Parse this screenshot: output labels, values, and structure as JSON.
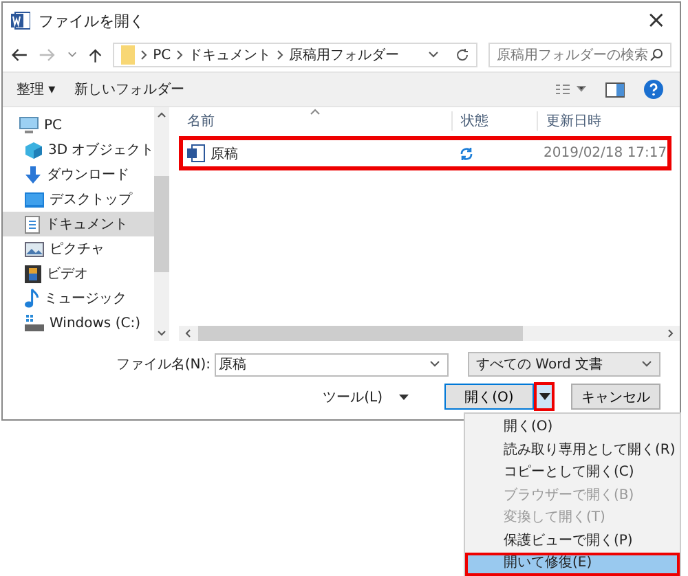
{
  "window": {
    "title": "ファイルを開く",
    "close": "×"
  },
  "address": {
    "crumbs": [
      "PC",
      "ドキュメント",
      "原稿用フォルダー"
    ],
    "search_placeholder": "原稿用フォルダーの検索"
  },
  "toolbar": {
    "organize": "整理 ▾",
    "new_folder": "新しいフォルダー"
  },
  "sidebar": {
    "items": [
      {
        "label": "PC",
        "kind": "pc",
        "selected": false
      },
      {
        "label": "3D オブジェクト",
        "kind": "cube",
        "selected": false
      },
      {
        "label": "ダウンロード",
        "kind": "download",
        "selected": false
      },
      {
        "label": "デスクトップ",
        "kind": "desktop",
        "selected": false
      },
      {
        "label": "ドキュメント",
        "kind": "document",
        "selected": true
      },
      {
        "label": "ピクチャ",
        "kind": "picture",
        "selected": false
      },
      {
        "label": "ビデオ",
        "kind": "video",
        "selected": false
      },
      {
        "label": "ミュージック",
        "kind": "music",
        "selected": false
      },
      {
        "label": "Windows (C:)",
        "kind": "drive",
        "selected": false
      }
    ]
  },
  "table": {
    "columns": [
      "名前",
      "状態",
      "更新日時"
    ],
    "rows": [
      {
        "name": "原稿",
        "date": "2019/02/18 17:17",
        "highlighted": true
      }
    ]
  },
  "footer": {
    "filename_label": "ファイル名(N):",
    "filename": "原稿",
    "filetype": "すべての Word 文書",
    "tools": "ツール(L)",
    "open": "開く(O)",
    "cancel": "キャンセル",
    "arrow_highlighted": true
  },
  "menu": {
    "items": [
      {
        "label": "開く(O)",
        "disabled": false,
        "highlighted": false
      },
      {
        "label": "読み取り専用として開く(R)",
        "disabled": false,
        "highlighted": false
      },
      {
        "label": "コピーとして開く(C)",
        "disabled": false,
        "highlighted": false
      },
      {
        "label": "ブラウザーで開く(B)",
        "disabled": true,
        "highlighted": false
      },
      {
        "label": "変換して開く(T)",
        "disabled": true,
        "highlighted": false
      },
      {
        "label": "保護ビューで開く(P)",
        "disabled": false,
        "highlighted": false
      },
      {
        "label": "開いて修復(E)",
        "disabled": false,
        "highlighted": true
      }
    ]
  }
}
